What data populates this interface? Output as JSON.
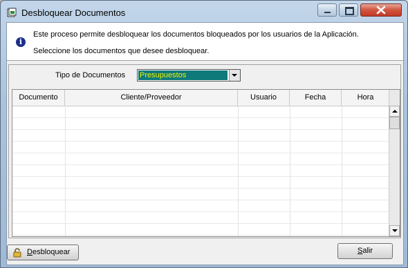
{
  "window": {
    "title": "Desbloquear Documentos",
    "controls": {
      "minimize": "minimize",
      "maximize": "maximize",
      "close": "close"
    }
  },
  "info": {
    "line1": "Este proceso permite desbloquear los documentos bloqueados por los usuarios de la Aplicación.",
    "line2": "Seleccione los documentos que desee desbloquear."
  },
  "filter": {
    "label": "Tipo de Documentos",
    "selected": "Presupuestos"
  },
  "table": {
    "columns": [
      "Documento",
      "Cliente/Proveedor",
      "Usuario",
      "Fecha",
      "Hora"
    ],
    "rows": []
  },
  "buttons": {
    "unlock_prefix": "D",
    "unlock_rest": "esbloquear",
    "exit_prefix": "S",
    "exit_rest": "alir"
  },
  "colors": {
    "combo_highlight_bg": "#0e7a7a",
    "combo_highlight_text": "#f2f200",
    "info_icon": "#1a2f8a"
  },
  "icons": [
    "window-app-icon",
    "info-icon",
    "lock-icon",
    "dropdown-arrow-icon"
  ]
}
